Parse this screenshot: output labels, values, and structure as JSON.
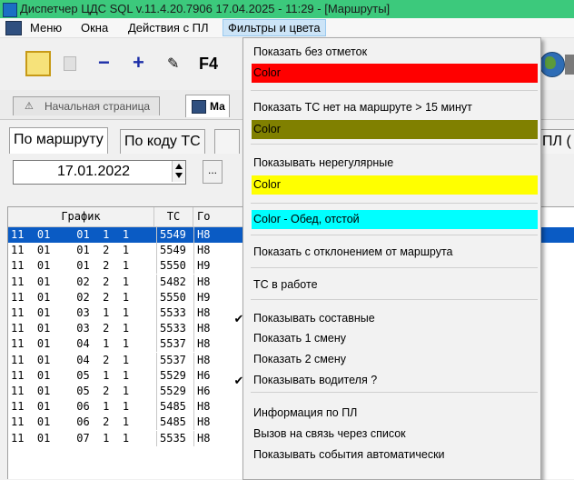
{
  "window": {
    "title": "Диспетчер ЦДС SQL  v.11.4.20.7906  17.04.2025 - 11:29 - [Маршруты]"
  },
  "menu": {
    "items": [
      "Меню",
      "Окна",
      "Действия с ПЛ",
      "Фильтры и цвета"
    ]
  },
  "toolbar": {
    "f4_label": "F4"
  },
  "tabs": {
    "home": "Начальная страница",
    "routes": "Ма"
  },
  "subtabs": [
    "По маршруту",
    "По коду ТС",
    "ПЛ ("
  ],
  "date": {
    "value": "17.01.2022",
    "button": "..."
  },
  "grid": {
    "headers": [
      "График",
      "ТС",
      "Го"
    ],
    "rows": [
      {
        "graph": "11  01    01  1  1",
        "ts": "5549",
        "go": "Н8"
      },
      {
        "graph": "11  01    01  2  1",
        "ts": "5549",
        "go": "Н8"
      },
      {
        "graph": "11  01    01  2  1",
        "ts": "5550",
        "go": "Н9"
      },
      {
        "graph": "11  01    02  2  1",
        "ts": "5482",
        "go": "Н8"
      },
      {
        "graph": "11  01    02  2  1",
        "ts": "5550",
        "go": "Н9"
      },
      {
        "graph": "11  01    03  1  1",
        "ts": "5533",
        "go": "Н8"
      },
      {
        "graph": "11  01    03  2  1",
        "ts": "5533",
        "go": "Н8"
      },
      {
        "graph": "11  01    04  1  1",
        "ts": "5537",
        "go": "Н8"
      },
      {
        "graph": "11  01    04  2  1",
        "ts": "5537",
        "go": "Н8"
      },
      {
        "graph": "11  01    05  1  1",
        "ts": "5529",
        "go": "Н6"
      },
      {
        "graph": "11  01    05  2  1",
        "ts": "5529",
        "go": "Н6"
      },
      {
        "graph": "11  01    06  1  1",
        "ts": "5485",
        "go": "Н8"
      },
      {
        "graph": "11  01    06  2  1",
        "ts": "5485",
        "go": "Н8"
      },
      {
        "graph": "11  01    07  1  1",
        "ts": "5535",
        "go": "Н8"
      }
    ]
  },
  "dropdown": {
    "items": [
      {
        "label": "Показать без отметок",
        "kind": "text"
      },
      {
        "label": "Color",
        "kind": "color",
        "bg": "#ff0000"
      },
      {
        "label": "Показать ТС нет на маршруте > 15 минут",
        "kind": "text"
      },
      {
        "label": "Color",
        "kind": "color",
        "bg": "#808000"
      },
      {
        "label": "Показывать нерегулярные",
        "kind": "text"
      },
      {
        "label": "Color",
        "kind": "color",
        "bg": "#ffff00"
      },
      {
        "label": "Color - Обед, отстой",
        "kind": "color",
        "bg": "#00ffff"
      },
      {
        "label": "Показать  с отклонением от маршрута",
        "kind": "text"
      },
      {
        "label": "ТС в работе",
        "kind": "text"
      },
      {
        "label": "Показывать составные",
        "kind": "text",
        "checked": true
      },
      {
        "label": "Показать 1 смену",
        "kind": "text"
      },
      {
        "label": "Показать 2 смену",
        "kind": "text"
      },
      {
        "label": "Показывать водителя ?",
        "kind": "text",
        "checked": true
      },
      {
        "label": "Информация по ПЛ",
        "kind": "text"
      },
      {
        "label": "Вызов на связь через список",
        "kind": "text"
      },
      {
        "label": "Показывать события автоматически",
        "kind": "text"
      }
    ]
  }
}
